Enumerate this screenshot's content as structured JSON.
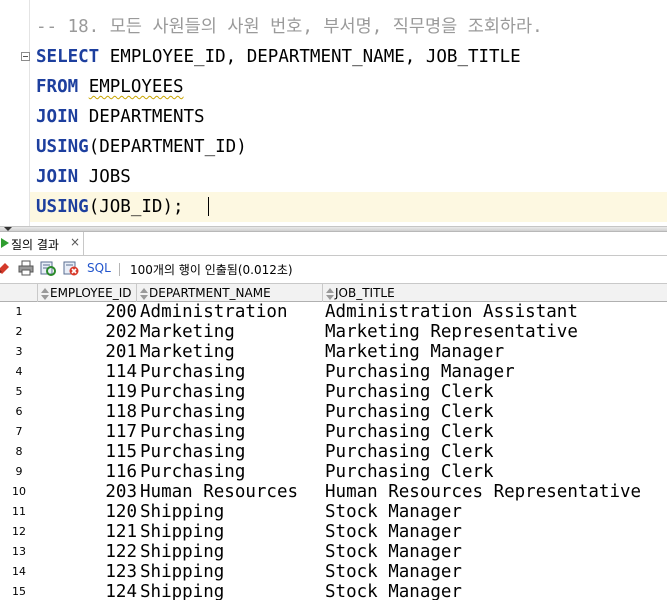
{
  "editor": {
    "lines": [
      {
        "parts": [
          {
            "t": "-- 18. 모든 사원들의 사원 번호, 부서명, 직무명을 조회하라.",
            "c": "cm"
          }
        ]
      },
      {
        "parts": [
          {
            "t": "SELECT",
            "c": "kw"
          },
          {
            "t": " EMPLOYEE_ID, DEPARTMENT_NAME, JOB_TITLE",
            "c": ""
          }
        ]
      },
      {
        "parts": [
          {
            "t": "FROM",
            "c": "kw"
          },
          {
            "t": " ",
            "c": ""
          },
          {
            "t": "EMPLOYEES",
            "c": "squig"
          }
        ]
      },
      {
        "parts": [
          {
            "t": "JOIN",
            "c": "kw"
          },
          {
            "t": " DEPARTMENTS",
            "c": ""
          }
        ]
      },
      {
        "parts": [
          {
            "t": "USING",
            "c": "kw"
          },
          {
            "t": "(DEPARTMENT_ID)",
            "c": ""
          }
        ]
      },
      {
        "parts": [
          {
            "t": "JOIN",
            "c": "kw"
          },
          {
            "t": " JOBS",
            "c": ""
          }
        ]
      },
      {
        "parts": [
          {
            "t": "USING",
            "c": "kw"
          },
          {
            "t": "(JOB_ID);",
            "c": ""
          }
        ]
      }
    ]
  },
  "tab": {
    "label": "질의 결과",
    "close": "×"
  },
  "toolbar": {
    "sql_label": "SQL",
    "status": "100개의 행이 인출됨(0.012초)"
  },
  "grid": {
    "columns": [
      "EMPLOYEE_ID",
      "DEPARTMENT_NAME",
      "JOB_TITLE"
    ],
    "rows": [
      [
        "1",
        "200",
        "Administration",
        "Administration Assistant"
      ],
      [
        "2",
        "202",
        "Marketing",
        "Marketing Representative"
      ],
      [
        "3",
        "201",
        "Marketing",
        "Marketing Manager"
      ],
      [
        "4",
        "114",
        "Purchasing",
        "Purchasing Manager"
      ],
      [
        "5",
        "119",
        "Purchasing",
        "Purchasing Clerk"
      ],
      [
        "6",
        "118",
        "Purchasing",
        "Purchasing Clerk"
      ],
      [
        "7",
        "117",
        "Purchasing",
        "Purchasing Clerk"
      ],
      [
        "8",
        "115",
        "Purchasing",
        "Purchasing Clerk"
      ],
      [
        "9",
        "116",
        "Purchasing",
        "Purchasing Clerk"
      ],
      [
        "10",
        "203",
        "Human Resources",
        "Human Resources Representative"
      ],
      [
        "11",
        "120",
        "Shipping",
        "Stock Manager"
      ],
      [
        "12",
        "121",
        "Shipping",
        "Stock Manager"
      ],
      [
        "13",
        "122",
        "Shipping",
        "Stock Manager"
      ],
      [
        "14",
        "123",
        "Shipping",
        "Stock Manager"
      ],
      [
        "15",
        "124",
        "Shipping",
        "Stock Manager"
      ]
    ]
  }
}
